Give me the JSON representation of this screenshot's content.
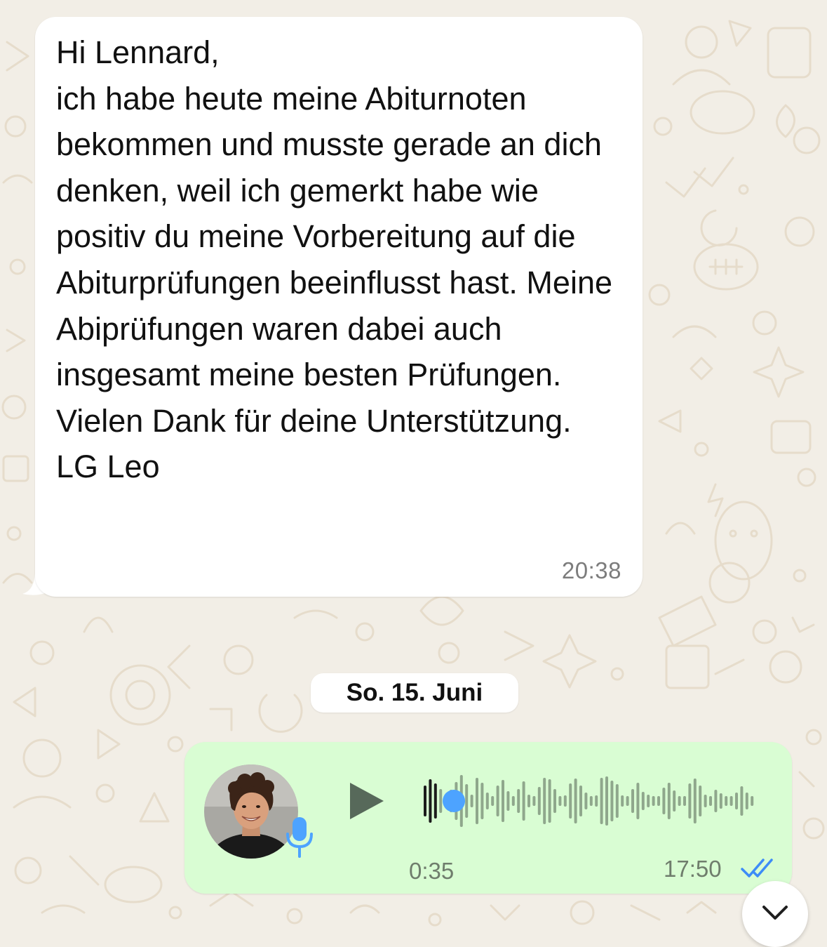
{
  "chat": {
    "background_color": "#f2eee6",
    "incoming_message": {
      "text": "Hi Lennard,\nich habe heute meine Abiturnoten bekommen und musste gerade an dich denken, weil ich gemerkt habe wie positiv du meine Vorbereitung auf die\nAbiturprüfungen beeinflusst hast. Meine Abiprüfungen waren dabei auch insgesamt meine besten Prüfungen. Vielen Dank für deine Unterstützung.\nLG Leo",
      "time": "20:38",
      "bubble_color": "#ffffff"
    },
    "date_separator": "So. 15. Juni",
    "voice_message": {
      "duration": "0:35",
      "time": "17:50",
      "progress": 0.06,
      "bubble_color": "#d9fdd3",
      "status_icon": "double-check-read-icon",
      "tick_color": "#3d8cf7",
      "playhead_color": "#4da3ff",
      "play_icon": "play-icon",
      "mic_icon": "microphone-icon"
    },
    "scroll_button_icon": "chevron-down-icon"
  }
}
